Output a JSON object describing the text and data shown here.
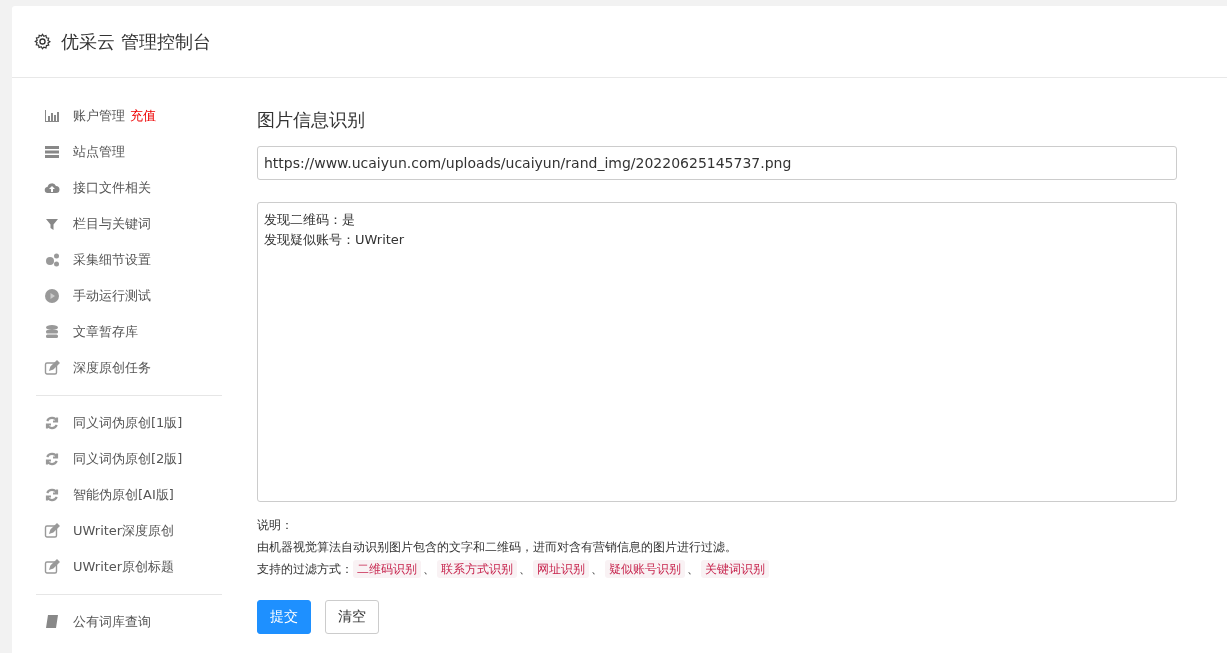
{
  "header": {
    "title": "优采云 管理控制台"
  },
  "sidebar": {
    "groups": [
      [
        {
          "label": "账户管理",
          "link": "充值"
        },
        {
          "label": "站点管理"
        },
        {
          "label": "接口文件相关"
        },
        {
          "label": "栏目与关键词"
        },
        {
          "label": "采集细节设置"
        },
        {
          "label": "手动运行测试"
        },
        {
          "label": "文章暂存库"
        },
        {
          "label": "深度原创任务"
        }
      ],
      [
        {
          "label": "同义词伪原创[1版]"
        },
        {
          "label": "同义词伪原创[2版]"
        },
        {
          "label": "智能伪原创[AI版]"
        },
        {
          "label": "UWriter深度原创"
        },
        {
          "label": "UWriter原创标题"
        }
      ],
      [
        {
          "label": "公有词库查询"
        }
      ]
    ]
  },
  "main": {
    "title": "图片信息识别",
    "url_field": {
      "value": "https://www.ucaiyun.com/uploads/ucaiyun/rand_img/20220625145737.png"
    },
    "result_lines": [
      "发现二维码：是",
      "发现疑似账号：UWriter"
    ],
    "notes_title": "说明：",
    "description": "由机器视觉算法自动识别图片包含的文字和二维码，进而对含有营销信息的图片进行过滤。",
    "methods_label": "支持的过滤方式：",
    "methods": [
      "二维码识别",
      "联系方式识别",
      "网址识别",
      "疑似账号识别",
      "关键词识别"
    ],
    "separator": "、",
    "buttons": [
      {
        "label": "提交",
        "kind": "primary"
      },
      {
        "label": "清空",
        "kind": "default"
      }
    ]
  }
}
